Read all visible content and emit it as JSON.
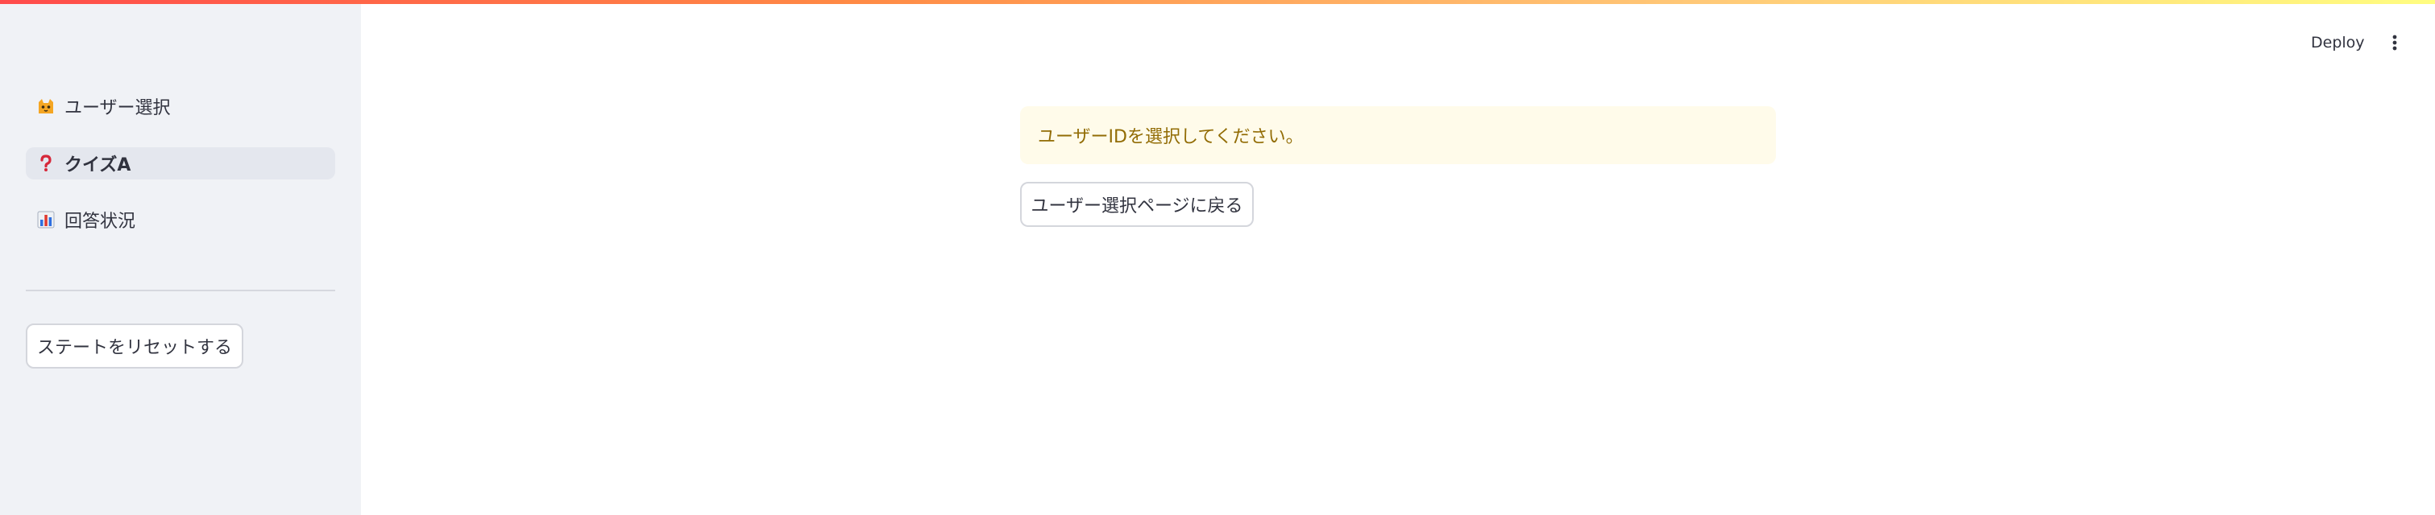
{
  "sidebar": {
    "nav_items": [
      {
        "label": "ユーザー選択",
        "icon": "cat-face-icon"
      },
      {
        "label": "クイズA",
        "icon": "question-mark-icon",
        "active": true
      },
      {
        "label": "回答状況",
        "icon": "bar-chart-icon"
      }
    ],
    "reset_button_label": "ステートをリセットする"
  },
  "header": {
    "deploy_label": "Deploy",
    "menu_icon": "kebab-menu-icon"
  },
  "main": {
    "warning_message": "ユーザーIDを選択してください。",
    "back_button_label": "ユーザー選択ページに戻る"
  },
  "colors": {
    "sidebar_bg": "#f0f2f6",
    "active_nav_bg": "#e4e7ee",
    "warning_bg": "#fffbea",
    "warning_text": "#926c05",
    "accent_gradient_start": "#ff4b4b",
    "accent_gradient_end": "#fffd80"
  }
}
